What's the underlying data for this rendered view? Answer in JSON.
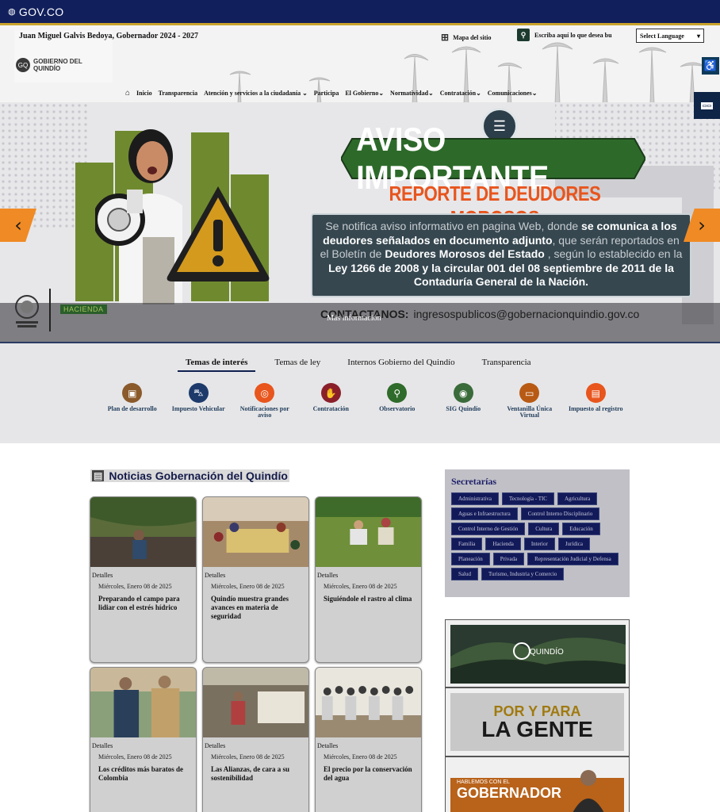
{
  "govbar": {
    "logo_text": "GOV.CO"
  },
  "header": {
    "governor": "Juan Miguel Galvis Bedoya, Gobernador 2024 - 2027",
    "logo_text": "GOBIERNO DEL QUINDÍO",
    "sitemap_label": "Mapa del sitio",
    "search_placeholder": "Escriba aquí lo que desea bu",
    "language_select": "Select Language",
    "nav": [
      "Inicio",
      "Transparencia",
      "Atención y servicios a la ciudadanía",
      "Participa",
      "El Gobierno",
      "Normatividad",
      "Contratación",
      "Comunicaciones"
    ]
  },
  "hero": {
    "title": "AVISO IMPORTANTE",
    "subtitle": "REPORTE DE DEUDORES MOROSOS",
    "notice_1": "Se notifica aviso informativo en pagina Web, donde ",
    "notice_2": "se comunica a los deudores señalados en documento adjunto",
    "notice_3": ", que serán reportados en el Boletín de ",
    "notice_4": "Deudores Morosos del Estado",
    "notice_5": " , según lo establecido en la ",
    "notice_6": "Ley 1266 de 2008 y la circular 001 del 08 septiembre de 2011 de la Contaduría  General de la Nación.",
    "contact_label": "CONTACTANOS:",
    "contact_email": "ingresospublicos@gobernacionquindio.gov.co",
    "more_info": "Más información",
    "hacienda_label": "HACIENDA"
  },
  "themes": {
    "tabs": [
      "Temas de interés",
      "Temas de ley",
      "Internos Gobierno del Quindío",
      "Transparencia"
    ],
    "items": [
      {
        "label": "Plan de desarrollo",
        "icon": "briefcase-icon",
        "color": "#8a5a2b"
      },
      {
        "label": "Impuesto Vehicular",
        "icon": "car-icon",
        "color": "#1d3a6b"
      },
      {
        "label": "Notificaciones por aviso",
        "icon": "bell-icon",
        "color": "#e8551d"
      },
      {
        "label": "Contratación",
        "icon": "handshake-icon",
        "color": "#8a1f2a"
      },
      {
        "label": "Observatorio",
        "icon": "magnifier-icon",
        "color": "#2f6b2a"
      },
      {
        "label": "SIG Quindío",
        "icon": "globe-icon",
        "color": "#3a6b3a"
      },
      {
        "label": "Ventanilla Única Virtual",
        "icon": "window-icon",
        "color": "#b85a14"
      },
      {
        "label": "Impuesto al registro",
        "icon": "document-icon",
        "color": "#e8551d"
      }
    ]
  },
  "news": {
    "title": "Noticias Gobernación del Quindío",
    "details_label": "Detalles",
    "cards": [
      {
        "date": "Miércoles, Enero 08 de 2025",
        "headline": "Preparando el campo para lidiar con el estrés hídrico"
      },
      {
        "date": "Miércoles, Enero 08 de 2025",
        "headline": "Quindío muestra grandes avances en materia de seguridad"
      },
      {
        "date": "Miércoles, Enero 08 de 2025",
        "headline": "Siguiéndole el rastro al clima"
      },
      {
        "date": "Miércoles, Enero 08 de 2025",
        "headline": "Los créditos más baratos de Colombia"
      },
      {
        "date": "Miércoles, Enero 08 de 2025",
        "headline": "Las Alianzas, de cara a su sostenibilidad"
      },
      {
        "date": "Miércoles, Enero 08 de 2025",
        "headline": "El precio por la conservación del agua"
      }
    ]
  },
  "secretarias": {
    "title": "Secretarías",
    "items": [
      "Administrativa",
      "Tecnología - TIC",
      "Agricultura",
      "Aguas e Infraestructura",
      "Control Interno Disciplinario",
      "Control Interno de Gestión",
      "Cultura",
      "Educación",
      "Familia",
      "Hacienda",
      "Interior",
      "Jurídica",
      "Planeación",
      "Privada",
      "Representación Judicial y Defensa",
      "Salud",
      "Turismo, Industria y Comercio"
    ]
  },
  "promos": {
    "quindio": "QUINDÍO",
    "gente_1": "POR Y PARA",
    "gente_2": "LA GENTE",
    "gob_1": "HABLEMOS CON EL",
    "gob_2": "GOBERNADOR"
  }
}
